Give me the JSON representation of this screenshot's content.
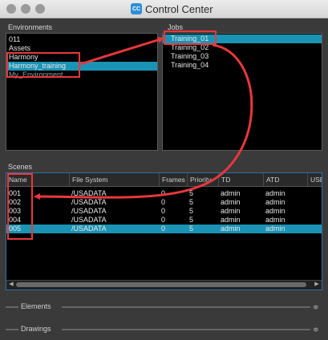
{
  "window": {
    "title": "Control Center",
    "app_icon": "CC"
  },
  "environments": {
    "label": "Environments",
    "items": [
      "011",
      "Assets",
      "Harmony",
      "Harmony_training",
      "My_Environment"
    ],
    "selected_index": 3
  },
  "jobs": {
    "label": "Jobs",
    "items": [
      "Training_01",
      "Training_02",
      "Training_03",
      "Training_04"
    ],
    "selected_index": 0
  },
  "scenes": {
    "label": "Scenes",
    "columns": [
      "Name",
      "File System",
      "Frames",
      "Priority",
      "TD",
      "ATD",
      "USE"
    ],
    "rows": [
      [
        "001",
        "/USADATA",
        "0",
        "5",
        "admin",
        "admin"
      ],
      [
        "002",
        "/USADATA",
        "0",
        "5",
        "admin",
        "admin"
      ],
      [
        "003",
        "/USADATA",
        "0",
        "5",
        "admin",
        "admin"
      ],
      [
        "004",
        "/USADATA",
        "0",
        "5",
        "admin",
        "admin"
      ],
      [
        "005",
        "/USADATA",
        "0",
        "5",
        "admin",
        "admin"
      ]
    ],
    "selected_index": 4
  },
  "sections": {
    "elements": "Elements",
    "drawings": "Drawings"
  },
  "colors": {
    "selection": "#1b93b4",
    "annotation": "#e8383d",
    "scenes_border": "#2f6ea5"
  }
}
